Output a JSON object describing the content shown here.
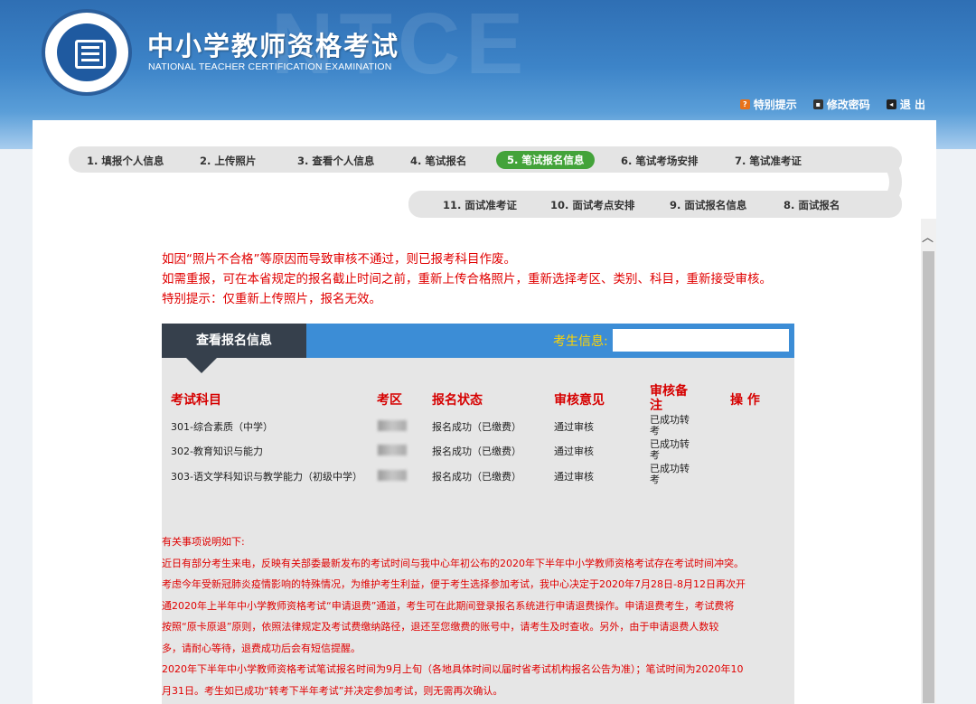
{
  "header": {
    "bg_text": "NTCE",
    "title_cn": "中小学教师资格考试",
    "title_en": "NATIONAL TEACHER CERTIFICATION EXAMINATION",
    "links": [
      {
        "label": "特别提示",
        "icon": "help-icon"
      },
      {
        "label": "修改密码",
        "icon": "key-icon"
      },
      {
        "label": "退 出",
        "icon": "exit-icon"
      }
    ]
  },
  "steps_row1": [
    "1. 填报个人信息",
    "2. 上传照片",
    "3. 查看个人信息",
    "4. 笔试报名",
    "5. 笔试报名信息",
    "6. 笔试考场安排",
    "7. 笔试准考证"
  ],
  "steps_row2": [
    "11. 面试准考证",
    "10. 面试考点安排",
    "9. 面试报名信息",
    "8. 面试报名"
  ],
  "active_step": "5. 笔试报名信息",
  "notice": [
    "如因“照片不合格”等原因而导致审核不通过，则已报考科目作废。",
    "如需重报，可在本省规定的报名截止时间之前，重新上传合格照片，重新选择考区、类别、科目，重新接受审核。",
    "特别提示：仅重新上传照片，报名无效。"
  ],
  "panel": {
    "tab": "查看报名信息",
    "candidate_label": "考生信息:",
    "candidate_value": ""
  },
  "table": {
    "headers": [
      "考试科目",
      "考区",
      "报名状态",
      "审核意见",
      "审核备注",
      "操 作"
    ],
    "rows": [
      {
        "subject": "301-综合素质（中学）",
        "status": "报名成功（已缴费）",
        "review": "通过审核",
        "remark": "已成功转考"
      },
      {
        "subject": "302-教育知识与能力",
        "status": "报名成功（已缴费）",
        "review": "通过审核",
        "remark": "已成功转考"
      },
      {
        "subject": "303-语文学科知识与教学能力（初级中学）",
        "status": "报名成功（已缴费）",
        "review": "通过审核",
        "remark": "已成功转考"
      }
    ]
  },
  "notes": [
    "有关事项说明如下:",
    "近日有部分考生来电，反映有关部委最新发布的考试时间与我中心年初公布的2020年下半年中小学教师资格考试存在考试时间冲突。",
    "考虑今年受新冠肺炎疫情影响的特殊情况，为维护考生利益，便于考生选择参加考试，我中心决定于2020年7月28日-8月12日再次开",
    "通2020年上半年中小学教师资格考试“申请退费”通道，考生可在此期间登录报名系统进行申请退费操作。申请退费考生，考试费将",
    "按照“原卡原退”原则，依照法律规定及考试费缴纳路径，退还至您缴费的账号中，请考生及时查收。另外，由于申请退费人数较",
    "多，请耐心等待，退费成功后会有短信提醒。",
    "2020年下半年中小学教师资格考试笔试报名时间为9月上旬（各地具体时间以届时省考试机构报名公告为准）；笔试时间为2020年10",
    "月31日。考生如已成功“转考下半年考试”并决定参加考试，则无需再次确认。"
  ]
}
